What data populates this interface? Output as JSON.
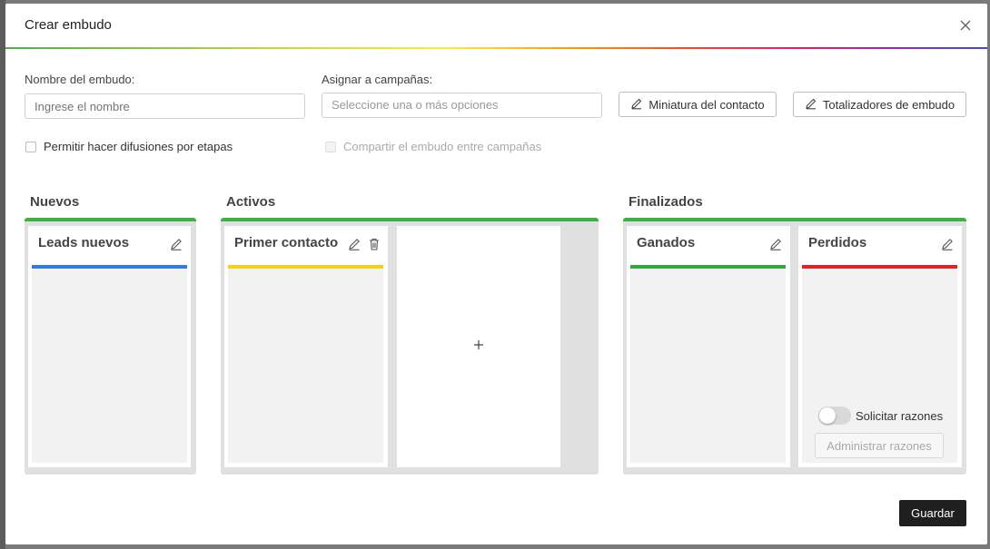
{
  "modal": {
    "title": "Crear embudo"
  },
  "form": {
    "name_label": "Nombre del embudo",
    "name_placeholder": "Ingrese el nombre",
    "campaigns_label": "Asignar a campañas",
    "campaigns_placeholder": "Seleccione una o más opciones",
    "contact_thumbnail_button": "Miniatura del contacto",
    "totalizers_button": "Totalizadores de embudo",
    "allow_broadcast_label": "Permitir hacer difusiones por etapas",
    "share_funnel_label": "Compartir el embudo entre campañas"
  },
  "groups": {
    "new": {
      "title": "Nuevos"
    },
    "active": {
      "title": "Activos"
    },
    "finished": {
      "title": "Finalizados"
    }
  },
  "stages": {
    "leads": {
      "name": "Leads nuevos",
      "color": "#2e7de0"
    },
    "first_contact": {
      "name": "Primer contacto",
      "color": "#f5d019"
    },
    "won": {
      "name": "Ganados",
      "color": "#2eaa3c"
    },
    "lost": {
      "name": "Perdidos",
      "color": "#e02424"
    }
  },
  "lost_stage": {
    "request_reasons_label": "Solicitar razones",
    "request_reasons_enabled": false,
    "manage_reasons_button": "Administrar razones"
  },
  "actions": {
    "save": "Guardar"
  },
  "colors": {
    "group_border": "#3cb043",
    "save_bg": "#1f1f1f"
  }
}
